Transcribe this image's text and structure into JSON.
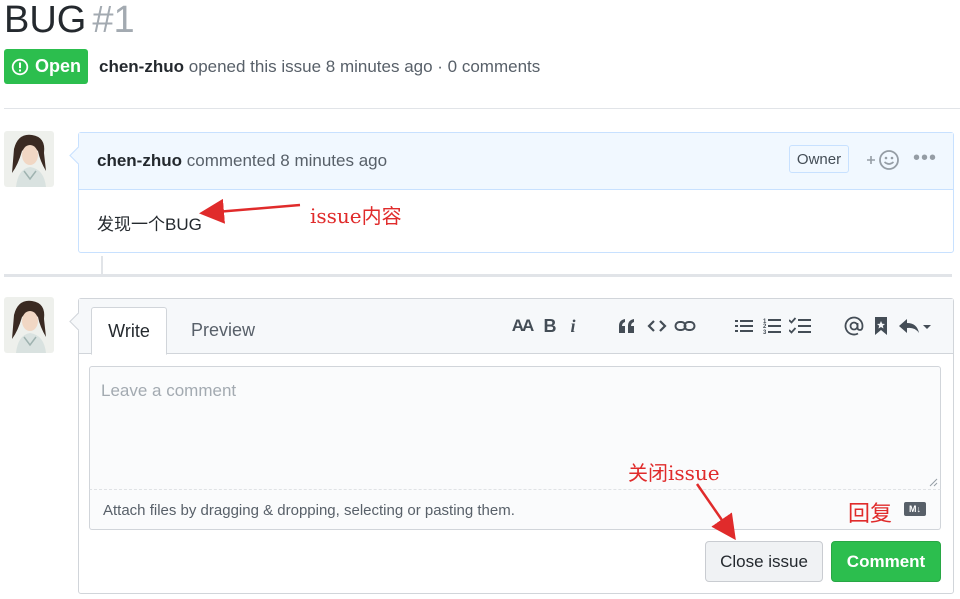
{
  "issue": {
    "title": "BUG",
    "number": "#1",
    "state": "Open",
    "author": "chen-zhuo",
    "meta_text": "opened this issue 8 minutes ago · 0 comments"
  },
  "comment": {
    "author": "chen-zhuo",
    "action": "commented 8 minutes ago",
    "role_badge": "Owner",
    "body": "发现一个BUG"
  },
  "editor": {
    "tab_write": "Write",
    "tab_preview": "Preview",
    "toolbar": {
      "heading": "AA",
      "bold": "B",
      "italic": "i"
    },
    "placeholder": "Leave a comment",
    "attach_text": "Attach files by dragging & dropping, selecting or pasting them.",
    "markdown_badge": "M↓",
    "close_button": "Close issue",
    "comment_button": "Comment"
  },
  "annotations": {
    "issue_content": "issue内容",
    "close_issue": "关闭issue",
    "reply": "回复"
  },
  "colors": {
    "open_green": "#2cbe4e",
    "annotation_red": "#e02b2b",
    "comment_header_bg": "#f1f8ff"
  }
}
